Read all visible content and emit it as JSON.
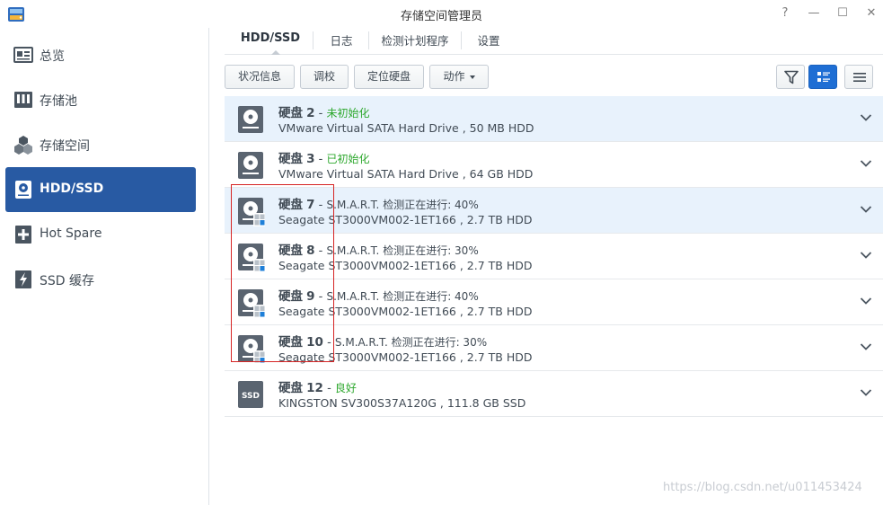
{
  "window": {
    "title": "存储空间管理员",
    "help": "?",
    "minimize": "—",
    "maximize": "☐",
    "close": "✕"
  },
  "sidebar": {
    "items": [
      {
        "label": "总览",
        "icon": "overview-icon",
        "active": false
      },
      {
        "label": "存储池",
        "icon": "storage-pool-icon",
        "active": false
      },
      {
        "label": "存储空间",
        "icon": "volume-icon",
        "active": false
      },
      {
        "label": "HDD/SSD",
        "icon": "hdd-icon",
        "active": true
      },
      {
        "label": "Hot Spare",
        "icon": "hot-spare-icon",
        "active": false
      },
      {
        "label": "SSD 缓存",
        "icon": "ssd-cache-icon",
        "active": false
      }
    ]
  },
  "tabs": [
    {
      "label": "HDD/SSD",
      "active": true
    },
    {
      "label": "日志",
      "active": false
    },
    {
      "label": "检测计划程序",
      "active": false
    },
    {
      "label": "设置",
      "active": false
    }
  ],
  "toolbar": {
    "status_info": "状况信息",
    "calibrate": "调校",
    "locate_disk": "定位硬盘",
    "action": "动作"
  },
  "disks": [
    {
      "name": "硬盘",
      "number": "2",
      "status": "未初始化",
      "status_color": "green",
      "detail": "VMware Virtual SATA Hard Drive , 50 MB HDD",
      "type": "hdd",
      "testing": false,
      "shaded": true
    },
    {
      "name": "硬盘",
      "number": "3",
      "status": "已初始化",
      "status_color": "green",
      "detail": "VMware Virtual SATA Hard Drive , 64 GB HDD",
      "type": "hdd",
      "testing": false,
      "shaded": false
    },
    {
      "name": "硬盘",
      "number": "7",
      "status": "S.M.A.R.T. 检测正在进行: 40%",
      "status_color": "gray",
      "detail": "Seagate ST3000VM002-1ET166 , 2.7 TB HDD",
      "type": "hdd",
      "testing": true,
      "shaded": true
    },
    {
      "name": "硬盘",
      "number": "8",
      "status": "S.M.A.R.T. 检测正在进行: 30%",
      "status_color": "gray",
      "detail": "Seagate ST3000VM002-1ET166 , 2.7 TB HDD",
      "type": "hdd",
      "testing": true,
      "shaded": false
    },
    {
      "name": "硬盘",
      "number": "9",
      "status": "S.M.A.R.T. 检测正在进行: 40%",
      "status_color": "gray",
      "detail": "Seagate ST3000VM002-1ET166 , 2.7 TB HDD",
      "type": "hdd",
      "testing": true,
      "shaded": false
    },
    {
      "name": "硬盘",
      "number": "10",
      "status": "S.M.A.R.T. 检测正在进行: 30%",
      "status_color": "gray",
      "detail": "Seagate ST3000VM002-1ET166 , 2.7 TB HDD",
      "type": "hdd",
      "testing": true,
      "shaded": false
    },
    {
      "name": "硬盘",
      "number": "12",
      "status": "良好",
      "status_color": "green",
      "detail": "KINGSTON SV300S37A120G , 111.8 GB SSD",
      "type": "ssd",
      "ssd_label": "SSD",
      "testing": false,
      "shaded": false
    }
  ],
  "watermark": "https://blog.csdn.net/u011453424",
  "colors": {
    "accent": "#285aa3",
    "status_green": "#2ea82e",
    "annotation": "#d62424",
    "row_highlight": "#e8f2fc"
  }
}
